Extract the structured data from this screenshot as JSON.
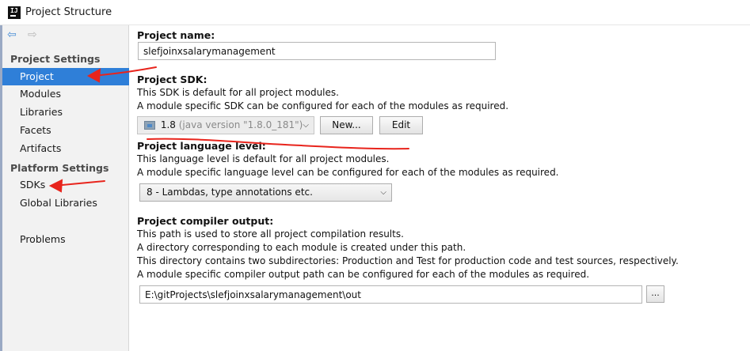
{
  "window": {
    "title": "Project Structure",
    "app_icon_text": "IJ"
  },
  "nav": {
    "back_icon": "arrow-left",
    "forward_icon": "arrow-right"
  },
  "sidebar": {
    "project_settings_label": "Project Settings",
    "project_settings_items": [
      "Project",
      "Modules",
      "Libraries",
      "Facets",
      "Artifacts"
    ],
    "platform_settings_label": "Platform Settings",
    "platform_settings_items": [
      "SDKs",
      "Global Libraries"
    ],
    "other_items": [
      "Problems"
    ],
    "selected": "Project"
  },
  "project_name": {
    "label": "Project name:",
    "value": "slefjoinxsalarymanagement"
  },
  "project_sdk": {
    "label": "Project SDK:",
    "desc1": "This SDK is default for all project modules.",
    "desc2": "A module specific SDK can be configured for each of the modules as required.",
    "selected_version": "1.8",
    "selected_detail": "(java version \"1.8.0_181\")",
    "new_button": "New...",
    "edit_button": "Edit"
  },
  "language_level": {
    "label": "Project language level:",
    "desc1": "This language level is default for all project modules.",
    "desc2": "A module specific language level can be configured for each of the modules as required.",
    "selected": "8 - Lambdas, type annotations etc."
  },
  "compiler_output": {
    "label": "Project compiler output:",
    "desc1": "This path is used to store all project compilation results.",
    "desc2": "A directory corresponding to each module is created under this path.",
    "desc3": "This directory contains two subdirectories: Production and Test for production code and test sources, respectively.",
    "desc4": "A module specific compiler output path can be configured for each of the modules as required.",
    "value": "E:\\gitProjects\\slefjoinxsalarymanagement\\out",
    "browse_button": "..."
  },
  "colors": {
    "selection": "#2f7fd8",
    "annotation_red": "#e8241c",
    "sidebar_bg": "#f2f2f2"
  }
}
